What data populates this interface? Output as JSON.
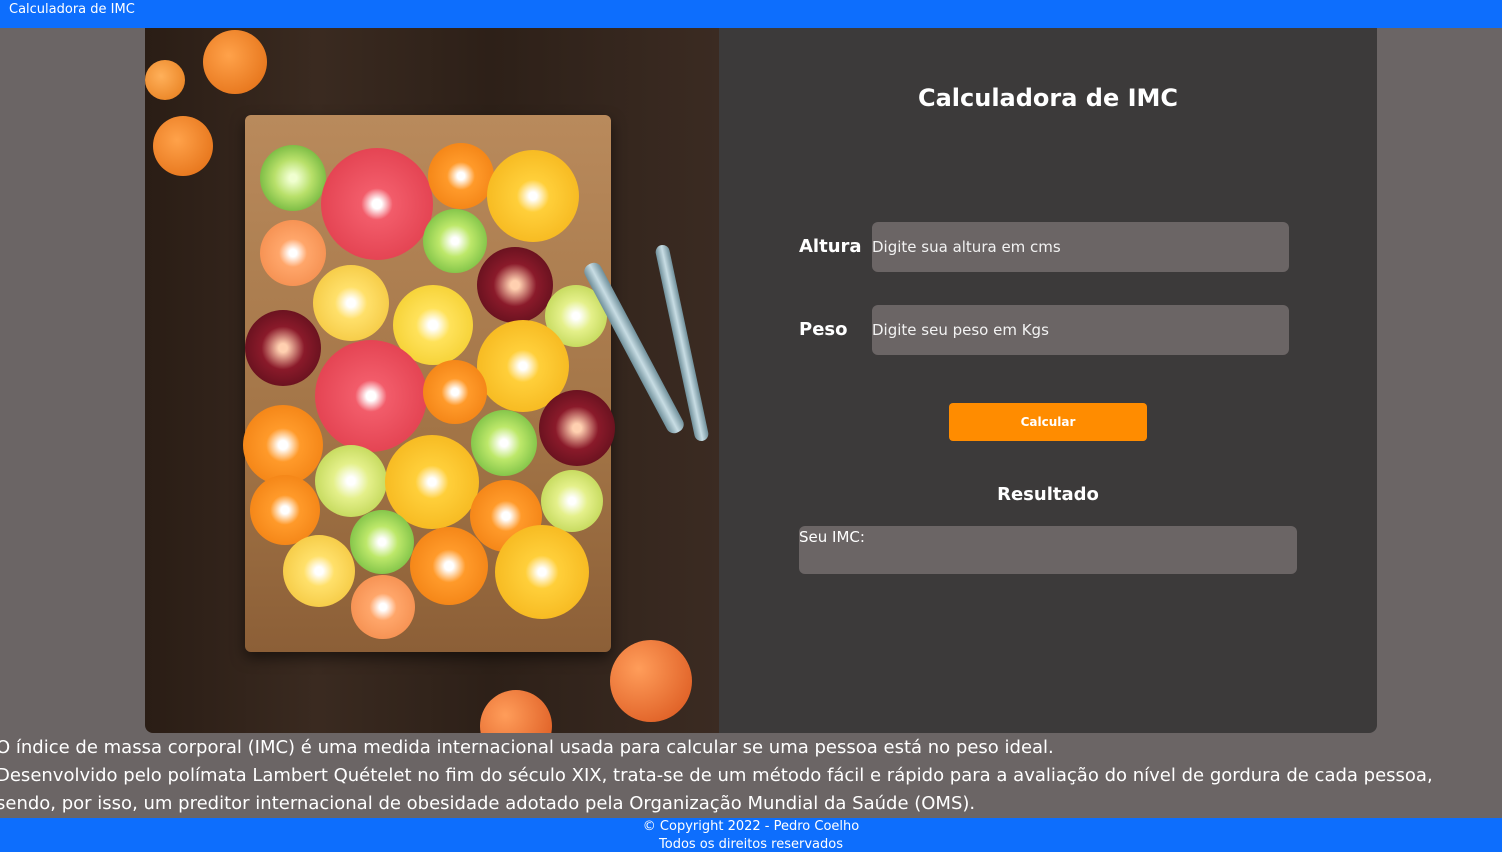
{
  "navbar": {
    "brand": "Calculadora de IMC",
    "color": "#0d6efd"
  },
  "hero_image": {
    "alt": "citrus fruits on a wooden cutting board"
  },
  "form": {
    "title": "Calculadora de IMC",
    "height_label": "Altura",
    "height_placeholder": "Digite sua altura em cms",
    "weight_label": "Peso",
    "weight_placeholder": "Digite seu peso em Kgs",
    "button_label": "Calcular",
    "button_color": "#ff8c00",
    "result_title": "Resultado",
    "result_text": "Seu IMC:"
  },
  "description": {
    "lines": [
      "O índice de massa corporal (IMC) é uma medida internacional usada para calcular se uma pessoa está no peso ideal.",
      "Desenvolvido pelo polímata Lambert Quételet no fim do século XIX, trata-se de um método fácil e rápido para a avaliação do nível de gordura de cada pessoa,",
      "sendo, por isso, um preditor internacional de obesidade adotado pela Organização Mundial da Saúde (OMS)."
    ]
  },
  "footer": {
    "copyright": "© Copyright 2022 - Pedro Coelho",
    "rights": "Todos os direitos reservados"
  }
}
